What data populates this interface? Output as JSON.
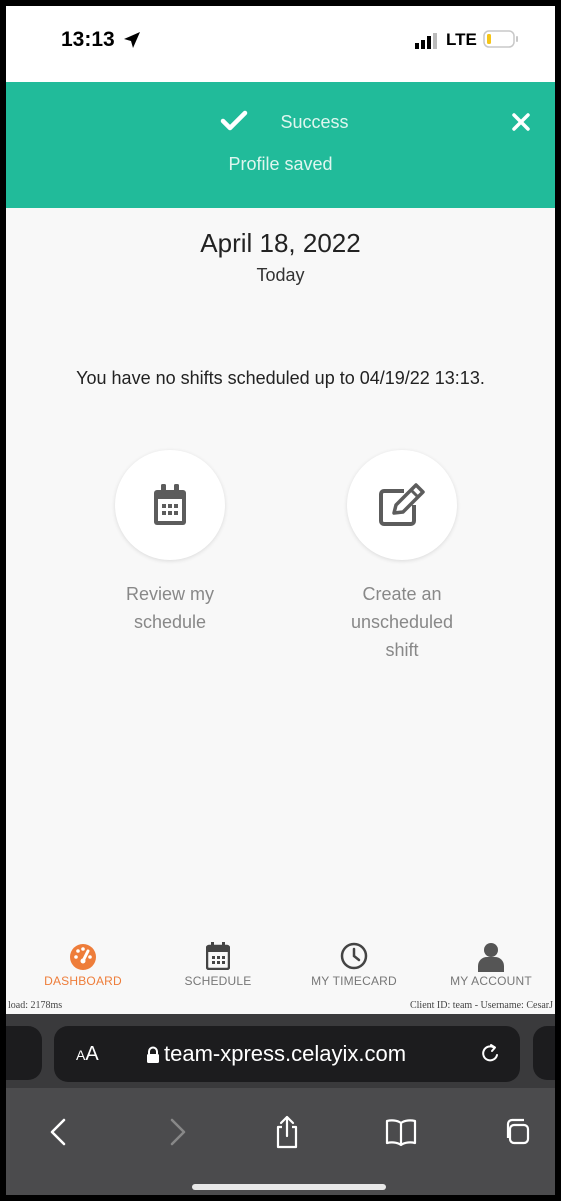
{
  "status_bar": {
    "time": "13:13",
    "network": "LTE"
  },
  "banner": {
    "title": "Success",
    "message": "Profile saved"
  },
  "main": {
    "date": "April 18, 2022",
    "day_label": "Today",
    "notice": "You have no shifts scheduled up to 04/19/22 13:13."
  },
  "actions": [
    {
      "label_lines": [
        "Review my",
        "schedule"
      ],
      "icon": "calendar-icon"
    },
    {
      "label_lines": [
        "Create an",
        "unscheduled",
        "shift"
      ],
      "icon": "edit-icon"
    }
  ],
  "nav": [
    {
      "label": "DASHBOARD",
      "icon": "dashboard-gauge-icon",
      "active": true
    },
    {
      "label": "SCHEDULE",
      "icon": "calendar-icon",
      "active": false
    },
    {
      "label": "MY TIMECARD",
      "icon": "clock-icon",
      "active": false
    },
    {
      "label": "MY ACCOUNT",
      "icon": "user-icon",
      "active": false
    }
  ],
  "footer": {
    "load_text": "load: 2178ms",
    "client_text": "Client ID: team - Username: CesarJ"
  },
  "safari": {
    "text_size_label": "AA",
    "url": "team-xpress.celayix.com"
  },
  "colors": {
    "banner": "#21bb9a",
    "active_nav": "#ee7d3a",
    "muted": "#888888"
  }
}
